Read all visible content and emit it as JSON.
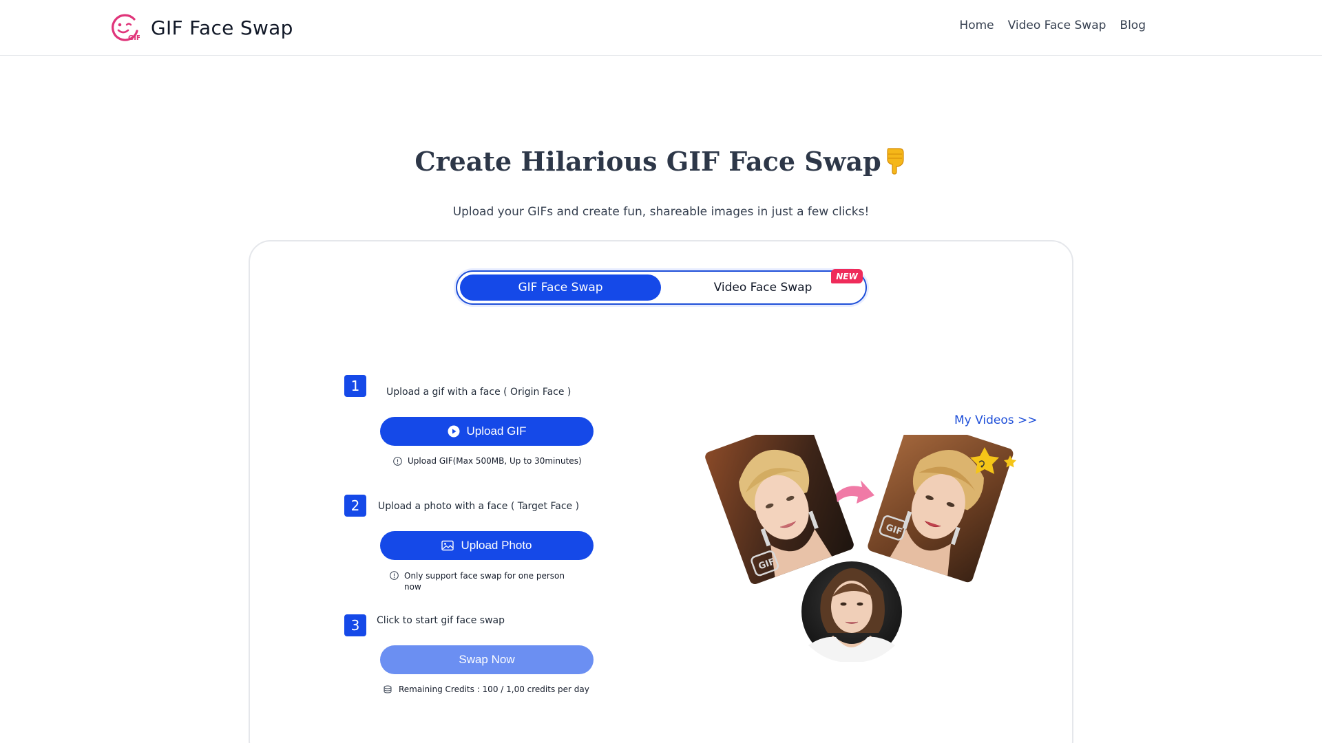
{
  "header": {
    "brand_name": "GIF Face Swap",
    "logo_text": "GIF",
    "nav": [
      {
        "label": "Home"
      },
      {
        "label": "Video Face Swap"
      },
      {
        "label": "Blog"
      }
    ]
  },
  "hero": {
    "title": "Create Hilarious GIF Face Swap",
    "title_emoji": "👇",
    "subtitle": "Upload your GIFs and create fun, shareable images in just a few clicks!"
  },
  "mode_toggle": {
    "tabs": [
      {
        "label": "GIF Face Swap",
        "active": true
      },
      {
        "label": "Video Face Swap",
        "active": false
      }
    ],
    "badge": "NEW"
  },
  "steps": [
    {
      "number": "1",
      "label": "Upload a gif with a face ( Origin Face )",
      "button": "Upload GIF",
      "hint": "Upload GIF(Max 500MB, Up to 30minutes)"
    },
    {
      "number": "2",
      "label": "Upload a photo with a face ( Target Face )",
      "button": "Upload Photo",
      "hint": "Only support face swap for one person now"
    },
    {
      "number": "3",
      "label": "Click to start gif face swap",
      "button": "Swap Now",
      "hint": "Remaining Credits : 100 / 1,00 credits per day"
    }
  ],
  "my_videos": "My Videos >>",
  "illustration": {
    "badge_text_left": "GIF",
    "badge_text_right": "GIF"
  },
  "colors": {
    "primary": "#1549e8",
    "primary_disabled": "#6b8ff2",
    "link": "#1d4ed8",
    "badge": "#ef2b5a",
    "logo": "#e0357a",
    "arrow": "#f07aa6",
    "star": "#f5c518"
  },
  "icons": {
    "upload_gif": "play-circle-icon",
    "upload_photo": "image-icon",
    "hint": "info-circle-icon",
    "credits": "coins-icon"
  }
}
